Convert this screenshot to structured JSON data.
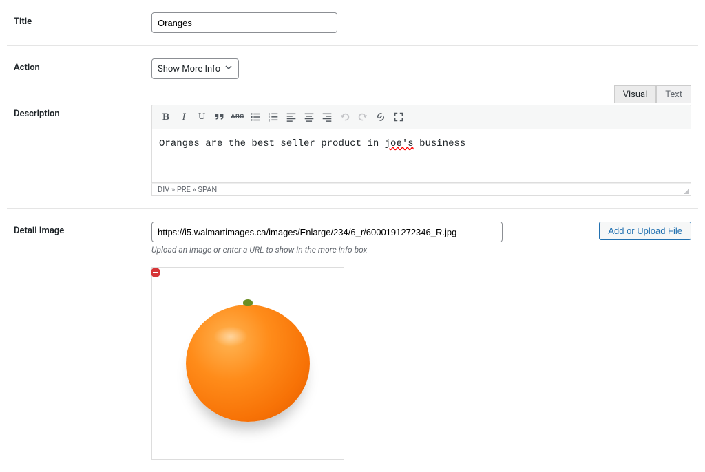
{
  "fields": {
    "title": {
      "label": "Title",
      "value": "Oranges"
    },
    "action": {
      "label": "Action",
      "selected": "Show More Info"
    },
    "description": {
      "label": "Description",
      "tabs": {
        "visual": "Visual",
        "text": "Text"
      },
      "content_pre": "Oranges are the best seller product in ",
      "content_err": "joe's",
      "content_post": " business",
      "statusbar": "DIV » PRE » SPAN"
    },
    "detailImage": {
      "label": "Detail Image",
      "url": "https://i5.walmartimages.ca/images/Enlarge/234/6_r/6000191272346_R.jpg",
      "hint": "Upload an image or enter a URL to show in the more info box",
      "button": "Add or Upload File"
    }
  }
}
